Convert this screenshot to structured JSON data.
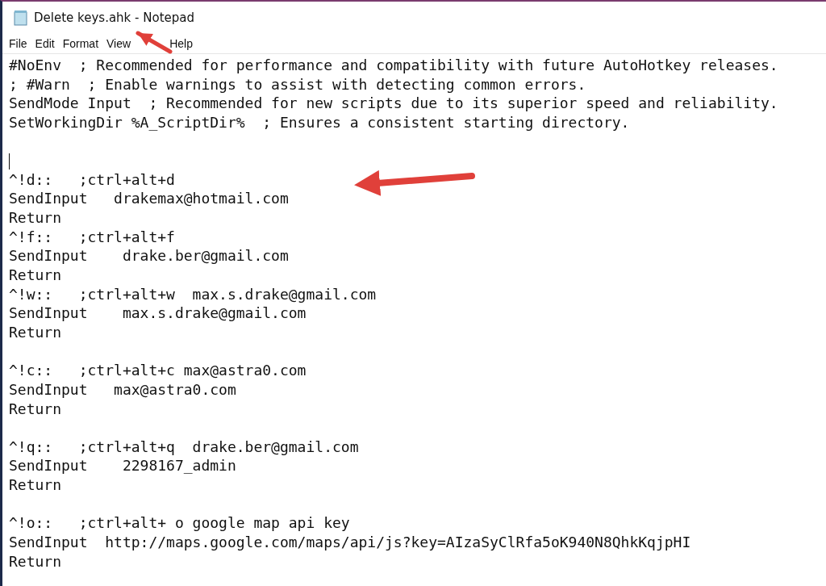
{
  "window": {
    "title": "Delete keys.ahk - Notepad"
  },
  "menu": [
    "File",
    "Edit",
    "Format",
    "View",
    "Help"
  ],
  "editor": {
    "lines": [
      {
        "kind": "text",
        "text": "#NoEnv  ; Recommended for performance and compatibility with future AutoHotkey releases."
      },
      {
        "kind": "text",
        "text": "; #Warn  ; Enable warnings to assist with detecting common errors."
      },
      {
        "kind": "text",
        "text": "SendMode Input  ; Recommended for new scripts due to its superior speed and reliability."
      },
      {
        "kind": "text",
        "text": "SetWorkingDir %A_ScriptDir%  ; Ensures a consistent starting directory."
      },
      {
        "kind": "blank",
        "caret": false
      },
      {
        "kind": "blank",
        "caret": true
      },
      {
        "kind": "text",
        "text": "^!d::   ;ctrl+alt+d"
      },
      {
        "kind": "text",
        "text": "SendInput   drakemax@hotmail.com"
      },
      {
        "kind": "text",
        "text": "Return"
      },
      {
        "kind": "text",
        "text": "^!f::   ;ctrl+alt+f"
      },
      {
        "kind": "text",
        "text": "SendInput    drake.ber@gmail.com"
      },
      {
        "kind": "text",
        "text": "Return"
      },
      {
        "kind": "text",
        "text": "^!w::   ;ctrl+alt+w  max.s.drake@gmail.com"
      },
      {
        "kind": "text",
        "text": "SendInput    max.s.drake@gmail.com"
      },
      {
        "kind": "text",
        "text": "Return"
      },
      {
        "kind": "blank",
        "caret": false
      },
      {
        "kind": "text",
        "text": "^!c::   ;ctrl+alt+c max@astra0.com"
      },
      {
        "kind": "text",
        "text": "SendInput   max@astra0.com"
      },
      {
        "kind": "text",
        "text": "Return"
      },
      {
        "kind": "blank",
        "caret": false
      },
      {
        "kind": "text",
        "text": "^!q::   ;ctrl+alt+q  drake.ber@gmail.com"
      },
      {
        "kind": "text",
        "text": "SendInput    2298167_admin"
      },
      {
        "kind": "text",
        "text": "Return"
      },
      {
        "kind": "blank",
        "caret": false
      },
      {
        "kind": "text",
        "text": "^!o::   ;ctrl+alt+ o google map api key"
      },
      {
        "kind": "text",
        "text": "SendInput  http://maps.google.com/maps/api/js?key=AIzaSyClRfa5oK940N8QhkKqjpHI"
      },
      {
        "kind": "text",
        "text": "Return"
      }
    ]
  }
}
